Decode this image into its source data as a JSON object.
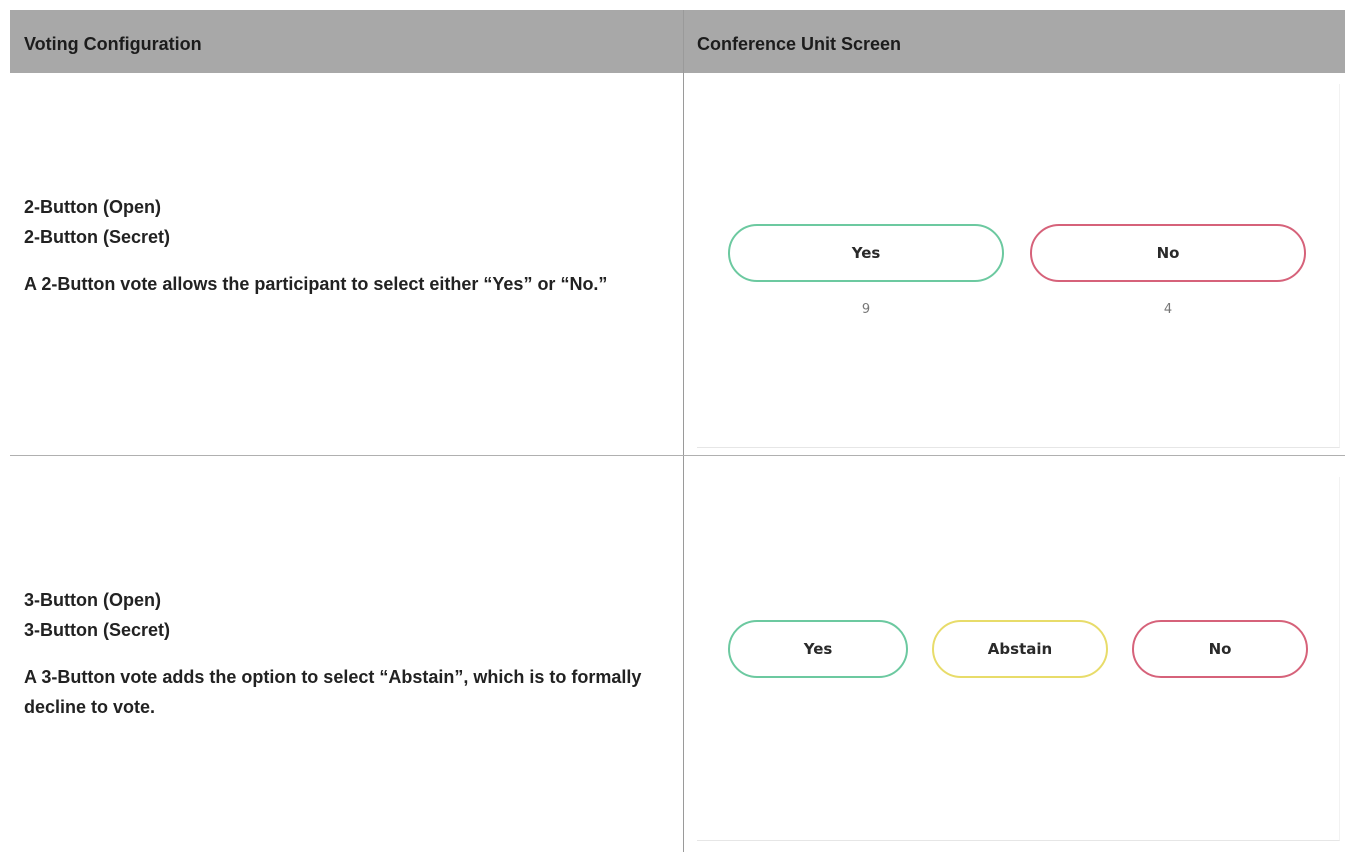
{
  "table": {
    "headers": [
      "Voting Configuration",
      "Conference Unit Screen"
    ],
    "rows": [
      {
        "configs": [
          "2-Button (Open)",
          "2-Button (Secret)"
        ],
        "description": "A 2-Button vote allows the participant to select either “Yes” or “No.”",
        "screen": {
          "buttons": [
            {
              "label": "Yes",
              "color": "#6cc9a0",
              "count": "9"
            },
            {
              "label": "No",
              "color": "#d6627a",
              "count": "4"
            }
          ]
        }
      },
      {
        "configs": [
          "3-Button (Open)",
          "3-Button (Secret)"
        ],
        "description": "A 3-Button vote adds the option to select “Abstain”, which is to formally decline to vote.",
        "screen": {
          "buttons": [
            {
              "label": "Yes",
              "color": "#6cc9a0"
            },
            {
              "label": "Abstain",
              "color": "#e8dc6a"
            },
            {
              "label": "No",
              "color": "#d6627a"
            }
          ]
        }
      }
    ]
  }
}
